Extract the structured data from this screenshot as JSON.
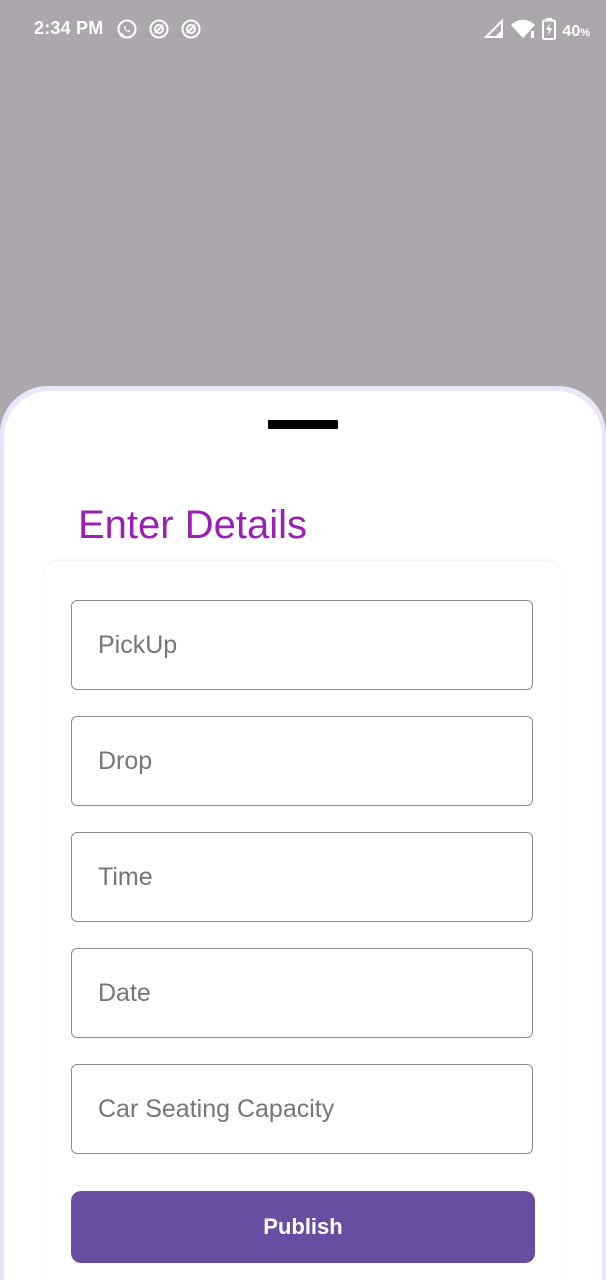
{
  "status_bar": {
    "time": "2:34 PM",
    "left_icons": [
      "whatsapp-icon",
      "sync-icon",
      "sync-icon"
    ],
    "right_icons": [
      "signal-icon",
      "wifi-icon",
      "battery-charging-icon"
    ],
    "battery_value": "40",
    "battery_unit": "%"
  },
  "sheet": {
    "title": "Enter Details",
    "fields": [
      {
        "placeholder": "PickUp",
        "value": ""
      },
      {
        "placeholder": "Drop",
        "value": ""
      },
      {
        "placeholder": "Time",
        "value": ""
      },
      {
        "placeholder": "Date",
        "value": ""
      },
      {
        "placeholder": "Car Seating Capacity",
        "value": ""
      }
    ],
    "publish_label": "Publish"
  },
  "colors": {
    "scrim": "#aca7ad",
    "title": "#9c1fb5",
    "button": "#684ea3",
    "sheet_outline": "#ebe6f7"
  }
}
